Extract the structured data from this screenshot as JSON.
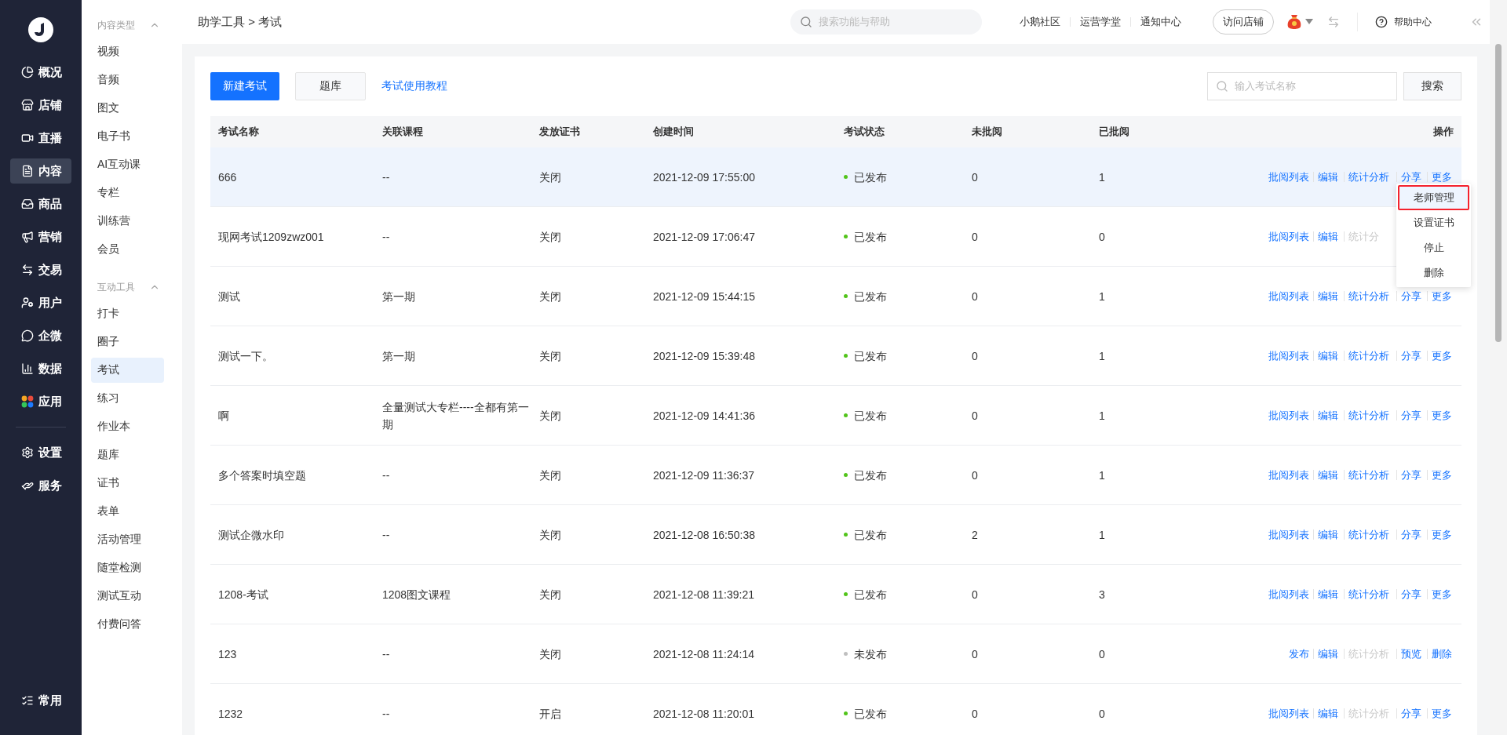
{
  "nav": {
    "items": [
      {
        "label": "概况",
        "selected": false
      },
      {
        "label": "店铺",
        "selected": false
      },
      {
        "label": "直播",
        "selected": false
      },
      {
        "label": "内容",
        "selected": true
      },
      {
        "label": "商品",
        "selected": false
      },
      {
        "label": "营销",
        "selected": false
      },
      {
        "label": "交易",
        "selected": false
      },
      {
        "label": "用户",
        "selected": false
      },
      {
        "label": "企微",
        "selected": false
      },
      {
        "label": "数据",
        "selected": false
      },
      {
        "label": "应用",
        "selected": false
      }
    ],
    "bottom_items": [
      {
        "label": "设置",
        "selected": false
      },
      {
        "label": "服务",
        "selected": false
      }
    ],
    "footer": {
      "label": "常用"
    }
  },
  "subnav": {
    "groups": [
      {
        "title": "内容类型",
        "expanded": true,
        "items": [
          {
            "label": "视频",
            "selected": false
          },
          {
            "label": "音频",
            "selected": false
          },
          {
            "label": "图文",
            "selected": false
          },
          {
            "label": "电子书",
            "selected": false
          },
          {
            "label": "AI互动课",
            "selected": false
          },
          {
            "label": "专栏",
            "selected": false
          },
          {
            "label": "训练营",
            "selected": false
          },
          {
            "label": "会员",
            "selected": false
          }
        ]
      },
      {
        "title": "互动工具",
        "expanded": true,
        "items": [
          {
            "label": "打卡",
            "selected": false
          },
          {
            "label": "圈子",
            "selected": false
          },
          {
            "label": "考试",
            "selected": true
          },
          {
            "label": "练习",
            "selected": false
          },
          {
            "label": "作业本",
            "selected": false
          },
          {
            "label": "题库",
            "selected": false
          },
          {
            "label": "证书",
            "selected": false
          },
          {
            "label": "表单",
            "selected": false
          },
          {
            "label": "活动管理",
            "selected": false
          },
          {
            "label": "随堂检测",
            "selected": false
          },
          {
            "label": "测试互动",
            "selected": false
          },
          {
            "label": "付费问答",
            "selected": false
          }
        ]
      }
    ]
  },
  "topbar": {
    "breadcrumb": "助学工具 > 考试",
    "search": {
      "placeholder": "搜索功能与帮助"
    },
    "links": [
      "小鹅社区",
      "运营学堂",
      "通知中心"
    ],
    "visit_button": "访问店铺",
    "help": "帮助中心"
  },
  "toolbar": {
    "primary_button": "新建考试",
    "secondary_button": "题库",
    "tutorial_link": "考试使用教程",
    "search": {
      "placeholder": "输入考试名称"
    },
    "search_button": "搜索"
  },
  "table": {
    "columns": [
      "考试名称",
      "关联课程",
      "发放证书",
      "创建时间",
      "考试状态",
      "未批阅",
      "已批阅",
      "操作"
    ],
    "rows": [
      {
        "name": "666",
        "course": "--",
        "certificate": "关闭",
        "created": "2021-12-09 17:55:00",
        "status": {
          "label": "已发布",
          "color": "#52c41a"
        },
        "unreviewed": "0",
        "reviewed": "1",
        "hovered": true,
        "actions": [
          {
            "label": "批阅列表",
            "disabled": false
          },
          {
            "label": "编辑",
            "disabled": false
          },
          {
            "label": "统计分析",
            "disabled": false
          },
          {
            "label": "分享",
            "disabled": false
          },
          {
            "label": "更多",
            "disabled": false
          }
        ]
      },
      {
        "name": "现网考试1209zwz001",
        "course": "--",
        "certificate": "关闭",
        "created": "2021-12-09 17:06:47",
        "status": {
          "label": "已发布",
          "color": "#52c41a"
        },
        "unreviewed": "0",
        "reviewed": "0",
        "hovered": false,
        "actions": [
          {
            "label": "批阅列表",
            "disabled": false
          },
          {
            "label": "编辑",
            "disabled": false
          },
          {
            "label": "统计分",
            "disabled": true
          }
        ]
      },
      {
        "name": "测试",
        "course": "第一期",
        "certificate": "关闭",
        "created": "2021-12-09 15:44:15",
        "status": {
          "label": "已发布",
          "color": "#52c41a"
        },
        "unreviewed": "0",
        "reviewed": "1",
        "hovered": false,
        "actions": [
          {
            "label": "批阅列表",
            "disabled": false
          },
          {
            "label": "编辑",
            "disabled": false
          },
          {
            "label": "统计分析",
            "disabled": false
          },
          {
            "label": "分享",
            "disabled": false
          },
          {
            "label": "更多",
            "disabled": false
          }
        ]
      },
      {
        "name": "测试一下。",
        "course": "第一期",
        "certificate": "关闭",
        "created": "2021-12-09 15:39:48",
        "status": {
          "label": "已发布",
          "color": "#52c41a"
        },
        "unreviewed": "0",
        "reviewed": "1",
        "hovered": false,
        "actions": [
          {
            "label": "批阅列表",
            "disabled": false
          },
          {
            "label": "编辑",
            "disabled": false
          },
          {
            "label": "统计分析",
            "disabled": false
          },
          {
            "label": "分享",
            "disabled": false
          },
          {
            "label": "更多",
            "disabled": false
          }
        ]
      },
      {
        "name": "啊",
        "course": "全量测试大专栏----全都有第一期",
        "certificate": "关闭",
        "created": "2021-12-09 14:41:36",
        "status": {
          "label": "已发布",
          "color": "#52c41a"
        },
        "unreviewed": "0",
        "reviewed": "1",
        "hovered": false,
        "actions": [
          {
            "label": "批阅列表",
            "disabled": false
          },
          {
            "label": "编辑",
            "disabled": false
          },
          {
            "label": "统计分析",
            "disabled": false
          },
          {
            "label": "分享",
            "disabled": false
          },
          {
            "label": "更多",
            "disabled": false
          }
        ]
      },
      {
        "name": "多个答案时填空题",
        "course": "--",
        "certificate": "关闭",
        "created": "2021-12-09 11:36:37",
        "status": {
          "label": "已发布",
          "color": "#52c41a"
        },
        "unreviewed": "0",
        "reviewed": "1",
        "hovered": false,
        "actions": [
          {
            "label": "批阅列表",
            "disabled": false
          },
          {
            "label": "编辑",
            "disabled": false
          },
          {
            "label": "统计分析",
            "disabled": false
          },
          {
            "label": "分享",
            "disabled": false
          },
          {
            "label": "更多",
            "disabled": false
          }
        ]
      },
      {
        "name": "测试企微水印",
        "course": "--",
        "certificate": "关闭",
        "created": "2021-12-08 16:50:38",
        "status": {
          "label": "已发布",
          "color": "#52c41a"
        },
        "unreviewed": "2",
        "reviewed": "1",
        "hovered": false,
        "actions": [
          {
            "label": "批阅列表",
            "disabled": false
          },
          {
            "label": "编辑",
            "disabled": false
          },
          {
            "label": "统计分析",
            "disabled": false
          },
          {
            "label": "分享",
            "disabled": false
          },
          {
            "label": "更多",
            "disabled": false
          }
        ]
      },
      {
        "name": "1208-考试",
        "course": "1208图文课程",
        "certificate": "关闭",
        "created": "2021-12-08 11:39:21",
        "status": {
          "label": "已发布",
          "color": "#52c41a"
        },
        "unreviewed": "0",
        "reviewed": "3",
        "hovered": false,
        "actions": [
          {
            "label": "批阅列表",
            "disabled": false
          },
          {
            "label": "编辑",
            "disabled": false
          },
          {
            "label": "统计分析",
            "disabled": false
          },
          {
            "label": "分享",
            "disabled": false
          },
          {
            "label": "更多",
            "disabled": false
          }
        ]
      },
      {
        "name": "123",
        "course": "--",
        "certificate": "关闭",
        "created": "2021-12-08 11:24:14",
        "status": {
          "label": "未发布",
          "color": "#bfbfbf"
        },
        "unreviewed": "0",
        "reviewed": "0",
        "hovered": false,
        "actions": [
          {
            "label": "发布",
            "disabled": false
          },
          {
            "label": "编辑",
            "disabled": false
          },
          {
            "label": "统计分析",
            "disabled": true
          },
          {
            "label": "预览",
            "disabled": false
          },
          {
            "label": "删除",
            "disabled": false
          }
        ]
      },
      {
        "name": "1232",
        "course": "--",
        "certificate": "开启",
        "created": "2021-12-08 11:20:01",
        "status": {
          "label": "已发布",
          "color": "#52c41a"
        },
        "unreviewed": "0",
        "reviewed": "0",
        "hovered": false,
        "actions": [
          {
            "label": "批阅列表",
            "disabled": false
          },
          {
            "label": "编辑",
            "disabled": false
          },
          {
            "label": "统计分析",
            "disabled": true
          },
          {
            "label": "分享",
            "disabled": false
          },
          {
            "label": "更多",
            "disabled": false
          }
        ]
      }
    ]
  },
  "dropdown": {
    "items": [
      {
        "label": "老师管理",
        "selected": true
      },
      {
        "label": "设置证书",
        "selected": false
      },
      {
        "label": "停止",
        "selected": false
      },
      {
        "label": "删除",
        "selected": false
      }
    ]
  }
}
